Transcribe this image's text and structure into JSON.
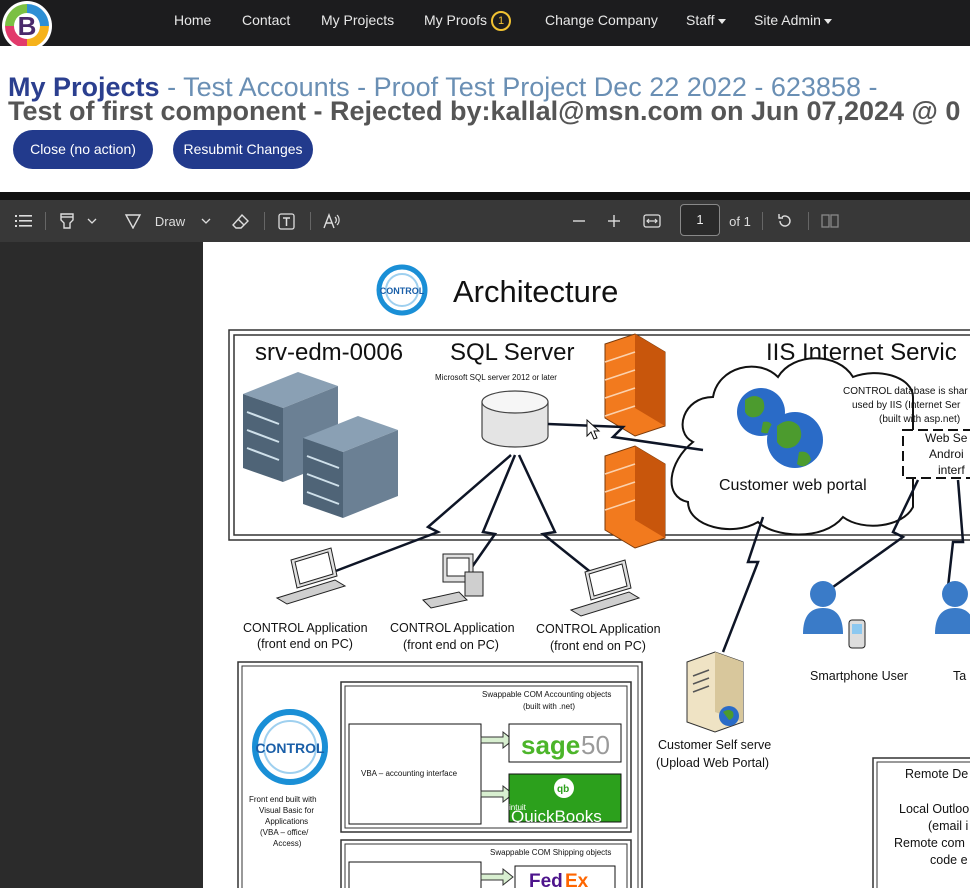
{
  "nav": {
    "home": "Home",
    "contact": "Contact",
    "my_projects": "My Projects",
    "my_proofs": "My Proofs",
    "proofs_count": "1",
    "change_company": "Change Company",
    "staff": "Staff",
    "site_admin": "Site Admin"
  },
  "header": {
    "title_strong": "My Projects",
    "title_rest": " - Test Accounts - Proof Test Project Dec 22 2022 - 623858 -",
    "subtitle": "Test of first component - Rejected by:kallal@msn.com on Jun 07,2024 @ 0"
  },
  "actions": {
    "close": "Close (no action)",
    "resubmit": "Resubmit Changes"
  },
  "toolbar": {
    "draw": "Draw",
    "page_number": "1",
    "page_total": "of 1"
  },
  "document": {
    "heading": "Architecture",
    "server_name": "srv-edm-0006",
    "sql_server": "SQL Server",
    "sql_version": "Microsoft SQL server 2012 or later",
    "iis": "IIS Internet Servic",
    "db_shared_1": "CONTROL database is shar",
    "db_shared_2": "used by IIS (Internet Ser",
    "db_shared_3": "(built with asp.net)",
    "web_services_1": "Web Se",
    "web_services_2": "Androi",
    "web_services_3": "interf",
    "customer_portal": "Customer web portal",
    "app1_line1": "CONTROL Application",
    "app1_line2": "(front end on PC)",
    "app2_line1": "CONTROL Application",
    "app2_line2": "(front end on PC)",
    "app3_line1": "CONTROL Application",
    "app3_line2": "(front end on PC)",
    "smartphone_user": "Smartphone User",
    "tablet_user": "Ta",
    "self_serve_1": "Customer Self serve",
    "self_serve_2": "(Upload Web Portal)",
    "logo_text": "CONTROL",
    "front_end_1": "Front end built with",
    "front_end_2": "Visual Basic for",
    "front_end_3": "Applications",
    "front_end_4": "(VBA – office/",
    "front_end_5": "Access)",
    "accounting_title_1": "Swappable COM Accounting objects",
    "accounting_title_2": "(built with .net)",
    "vba_accounting": "VBA – accounting interface",
    "sage": "sage",
    "sage_num": "50",
    "qb_intuit": "intuit",
    "qb": "QuickBooks",
    "qb_logo": "qb",
    "shipping_title": "Swappable COM Shipping objects",
    "fedex_fed": "Fed",
    "fedex_ex": "Ex",
    "remote_1": "Remote De",
    "remote_2": "Local Outloo",
    "remote_3": "(email i",
    "remote_4": "Remote com",
    "remote_5": "code e"
  }
}
